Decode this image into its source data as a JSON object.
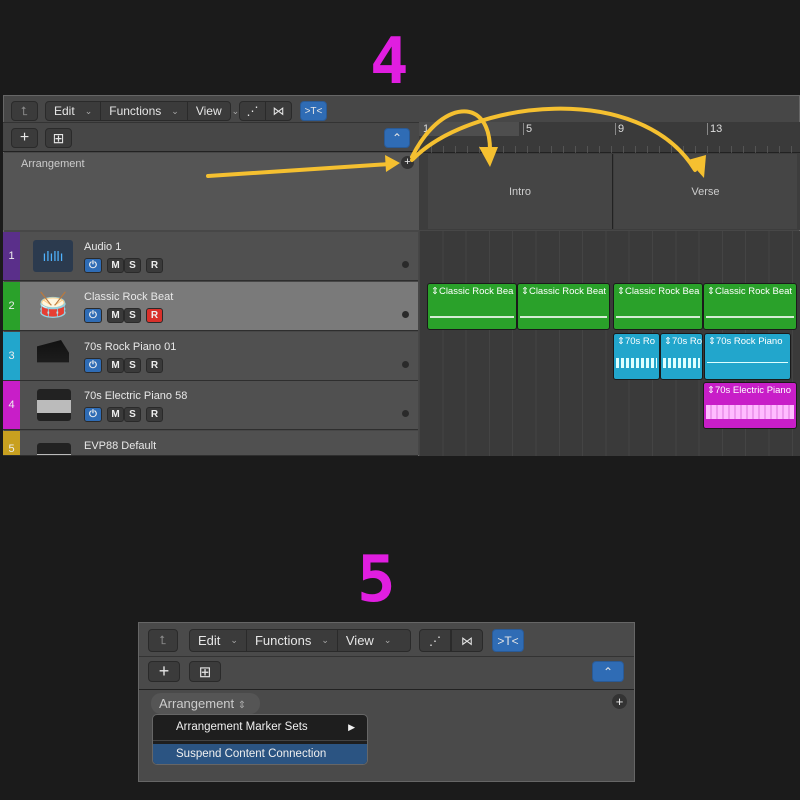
{
  "steps": {
    "first": "4",
    "second": "5"
  },
  "toolbar": {
    "back": "⮤",
    "edit": "Edit",
    "functions": "Functions",
    "view": "View",
    "chevron": "⌄",
    "automation": "⋰",
    "flex": "⋈",
    "catch": ">T<",
    "add": "+",
    "add_duplicate": "⊞",
    "collapse": "⌃"
  },
  "arrangement": {
    "title": "Arrangement",
    "add": "+",
    "markers": [
      "Intro",
      "Verse"
    ]
  },
  "ruler": {
    "bars": [
      "1",
      "5",
      "9",
      "13"
    ]
  },
  "tracks": [
    {
      "num": "1",
      "name": "Audio 1",
      "color": "#5a2f8a",
      "record_armed": false
    },
    {
      "num": "2",
      "name": "Classic Rock Beat",
      "color": "#2aa12a",
      "record_armed": true
    },
    {
      "num": "3",
      "name": "70s Rock Piano 01",
      "color": "#22a6cc",
      "record_armed": false
    },
    {
      "num": "4",
      "name": "70s Electric Piano 58",
      "color": "#c81ec8",
      "record_armed": false
    },
    {
      "num": "5",
      "name": "EVP88 Default",
      "color": "#c8a020",
      "record_armed": false
    }
  ],
  "track_buttons": {
    "power": "⏻",
    "mute": "M",
    "solo": "S",
    "record": "R"
  },
  "regions": {
    "drums": [
      "Classic Rock Bea",
      "Classic Rock Beat",
      "Classic Rock Bea",
      "Classic Rock Beat"
    ],
    "piano": [
      "70s Ro",
      "70s Ro",
      "70s Rock Piano"
    ],
    "epiano": [
      "70s Electric Piano"
    ]
  },
  "panel2": {
    "arrangement_label": "Arrangement",
    "updown": "⇕",
    "menu": [
      {
        "label": "Arrangement Marker Sets",
        "submenu": "▶"
      },
      {
        "label": "Suspend Content Connection",
        "highlighted": true
      }
    ]
  },
  "colors": {
    "arrow": "#f5c030",
    "green": "#2aa12a",
    "cyan": "#22a6cc",
    "magenta": "#c81ec8",
    "accent": "#2f6cb5",
    "record": "#d9302a"
  }
}
